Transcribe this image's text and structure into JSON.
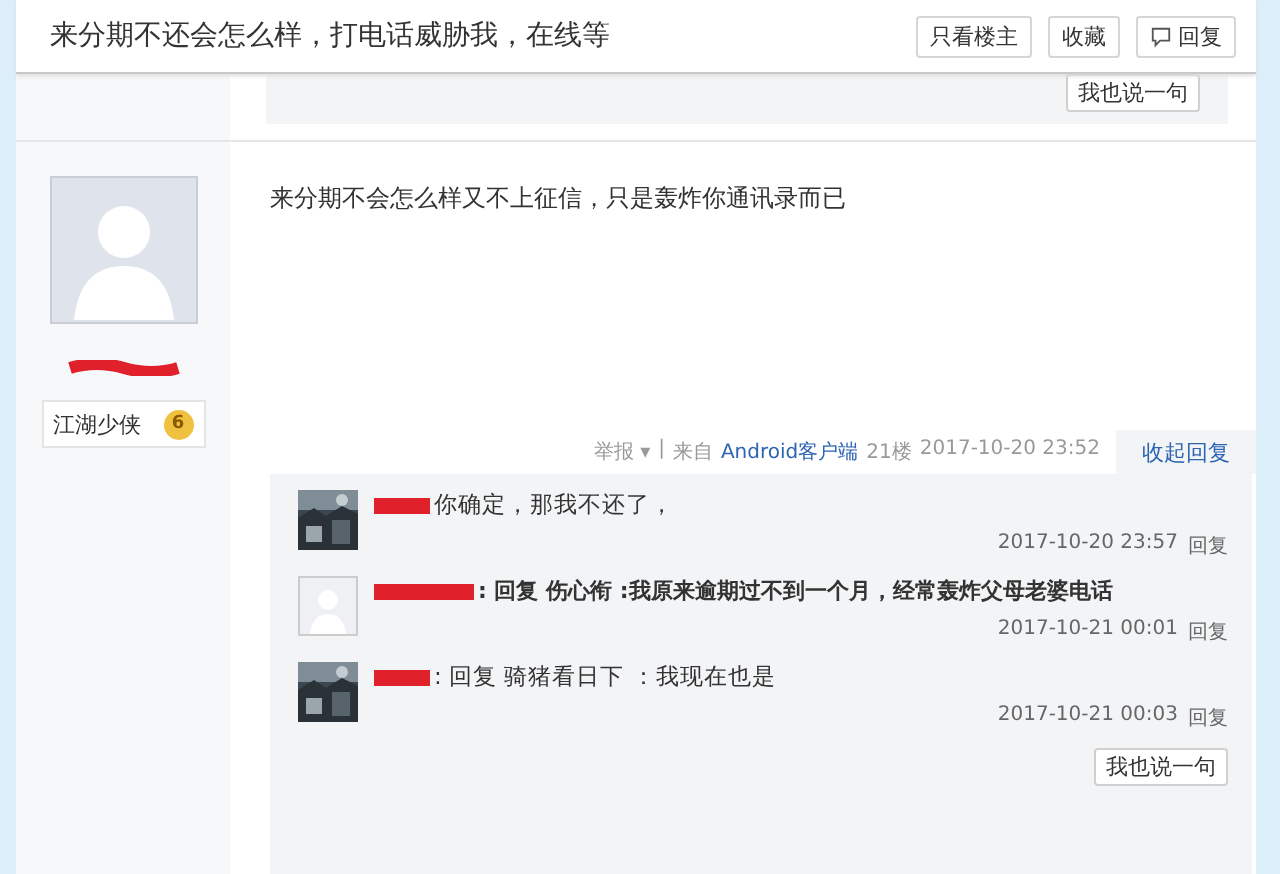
{
  "header": {
    "title": "来分期不还会怎么样，打电话威胁我，在线等",
    "buttons": [
      {
        "label": "只看楼主",
        "kind": "plain"
      },
      {
        "label": "收藏",
        "kind": "plain"
      },
      {
        "label": "回复",
        "kind": "reply"
      }
    ]
  },
  "previous_post": {
    "comment_button": "我也说一句"
  },
  "post": {
    "author_level": "江湖少侠",
    "level_badge": "6",
    "content": "来分期不会怎么样又不上征信，只是轰炸你通讯录而已",
    "tail": {
      "report": "举报",
      "report_caret": "▾",
      "separator": "|",
      "source_prefix": "来自",
      "source": "Android客户端",
      "floor": "21楼",
      "time": "2017-10-20 23:52"
    },
    "collapse_link": "收起回复",
    "comments": [
      {
        "text": "你确定，那我不还了，",
        "bold": false,
        "time": "2017-10-20 23:57",
        "reply": "回复"
      },
      {
        "kind": "default",
        "text": ": 回复 伤心衔 :我原来逾期过不到一个月，经常轰炸父母老婆电话",
        "bold": true,
        "time": "2017-10-21 00:01",
        "reply": "回复"
      },
      {
        "text": ": 回复 骑猪看日下 ：我现在也是",
        "bold": false,
        "time": "2017-10-21 00:03",
        "reply": "回复"
      }
    ],
    "comment_button": "我也说一句"
  }
}
